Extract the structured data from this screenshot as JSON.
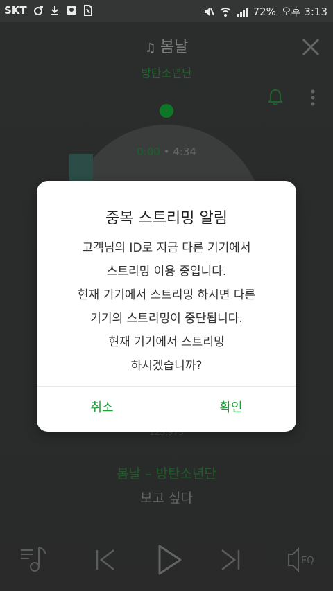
{
  "status_bar": {
    "carrier": "SKT",
    "battery": "72%",
    "time": "오후 3:13",
    "icons": [
      "record-icon",
      "download-icon",
      "app-icon",
      "sim-icon",
      "mute-icon",
      "wifi-icon",
      "signal-icon"
    ]
  },
  "player": {
    "song_title": "봄날",
    "artist": "방탄소년단",
    "time_current": "0:00",
    "time_separator": "•",
    "time_total": "4:34",
    "count": "123,973",
    "lyrics_title": "봄날 – 방탄소년단",
    "lyrics_line": "보고 싶다",
    "eq_label": "EQ",
    "accent_color": "#13a437"
  },
  "dialog": {
    "title": "중복 스트리밍 알림",
    "message_lines": [
      "고객님의 ID로 지금 다른 기기에서",
      "스트리밍 이용 중입니다.",
      "현재 기기에서 스트리밍 하시면 다른",
      "기기의 스트리밍이 중단됩니다.",
      "현재 기기에서 스트리밍",
      "하시겠습니까?"
    ],
    "cancel_label": "취소",
    "confirm_label": "확인",
    "button_color": "#1da036"
  }
}
